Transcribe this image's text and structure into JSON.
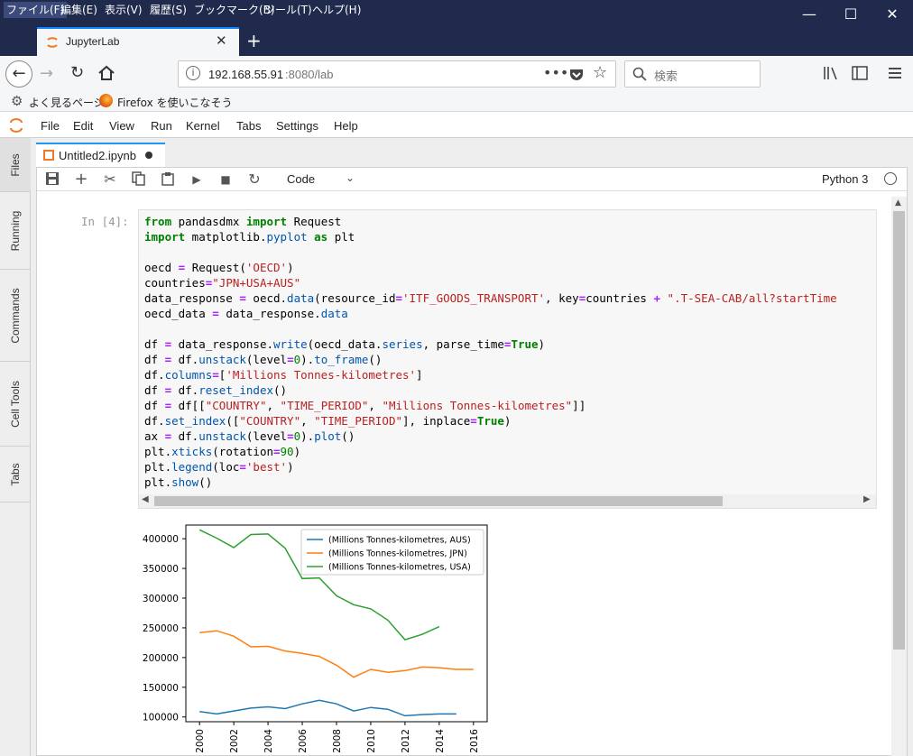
{
  "os_menu": [
    "ファイル(F)",
    "編集(E)",
    "表示(V)",
    "履歴(S)",
    "ブックマーク(B)",
    "ツール(T)",
    "ヘルプ(H)"
  ],
  "browser": {
    "tab_title": "JupyterLab",
    "url_host": "192.168.55.91",
    "url_rest": ":8080/lab",
    "search_placeholder": "検索",
    "bookmarks": [
      "よく見るページ",
      "Firefox を使いこなそう"
    ]
  },
  "jupyter": {
    "menu": [
      "File",
      "Edit",
      "View",
      "Run",
      "Kernel",
      "Tabs",
      "Settings",
      "Help"
    ],
    "sidebar": [
      "Files",
      "Running",
      "Commands",
      "Cell Tools",
      "Tabs"
    ],
    "doc_tab": "Untitled2.ipynb",
    "cell_type": "Code",
    "kernel": "Python 3",
    "prompt": "In [4]:"
  },
  "code_lines": [
    "from pandasdmx import Request",
    "import matplotlib.pyplot as plt",
    "",
    "oecd = Request('OECD')",
    "countries=\"JPN+USA+AUS\"",
    "data_response = oecd.data(resource_id='ITF_GOODS_TRANSPORT', key=countries + \".T-SEA-CAB/all?startTime",
    "oecd_data = data_response.data",
    "",
    "df = data_response.write(oecd_data.series, parse_time=True)",
    "df = df.unstack(level=0).to_frame()",
    "df.columns=['Millions Tonnes-kilometres']",
    "df = df.reset_index()",
    "df = df[[\"COUNTRY\", \"TIME_PERIOD\", \"Millions Tonnes-kilometres\"]]",
    "df.set_index([\"COUNTRY\", \"TIME_PERIOD\"], inplace=True)",
    "ax = df.unstack(level=0).plot()",
    "plt.xticks(rotation=90)",
    "plt.legend(loc='best')",
    "plt.show()"
  ],
  "chart_data": {
    "type": "line",
    "x": [
      2000,
      2001,
      2002,
      2003,
      2004,
      2005,
      2006,
      2007,
      2008,
      2009,
      2010,
      2011,
      2012,
      2013,
      2014,
      2015,
      2016
    ],
    "xticks": [
      2000,
      2002,
      2004,
      2006,
      2008,
      2010,
      2012,
      2014,
      2016
    ],
    "yticks": [
      100000,
      150000,
      200000,
      250000,
      300000,
      350000,
      400000
    ],
    "ylim": [
      92000,
      423000
    ],
    "xlim": [
      1999.2,
      2016.8
    ],
    "legend": "top-right",
    "series": [
      {
        "name": "(Millions Tonnes-kilometres, AUS)",
        "color": "#1f77b4",
        "values": [
          109000,
          105000,
          110000,
          115000,
          117000,
          114000,
          122000,
          128000,
          122000,
          110000,
          116000,
          113000,
          102000,
          104000,
          105000,
          105000,
          null
        ]
      },
      {
        "name": "(Millions Tonnes-kilometres, JPN)",
        "color": "#ff7f0e",
        "values": [
          242000,
          245000,
          236000,
          218000,
          219000,
          211000,
          207000,
          202000,
          187000,
          167000,
          180000,
          175000,
          178000,
          184000,
          183000,
          180000,
          180000
        ]
      },
      {
        "name": "(Millions Tonnes-kilometres, USA)",
        "color": "#2ca02c",
        "values": [
          415000,
          401000,
          385000,
          407000,
          408000,
          384000,
          333000,
          334000,
          304000,
          289000,
          282000,
          263000,
          230000,
          239000,
          252000,
          null,
          null
        ]
      }
    ]
  }
}
